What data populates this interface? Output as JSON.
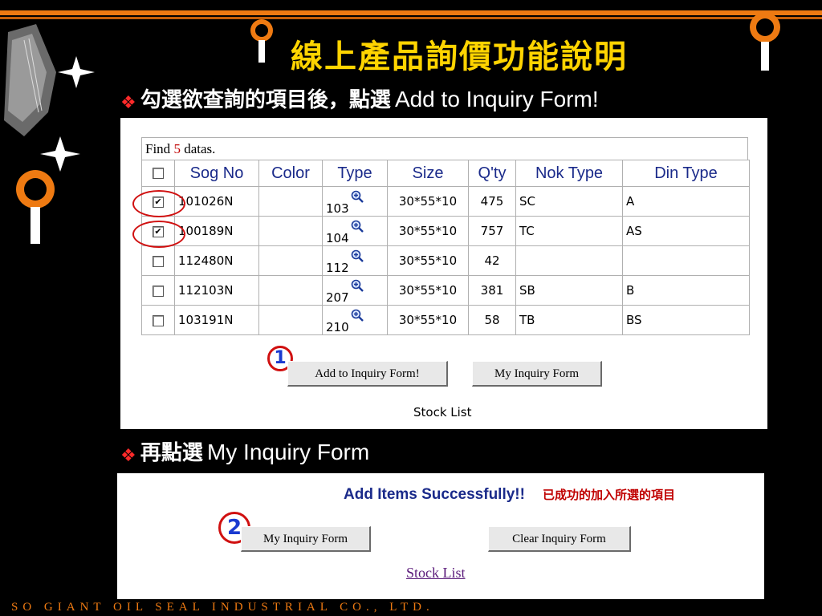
{
  "slide": {
    "title": "線上產品詢價功能說明",
    "bullet1_zh": "勾選欲查詢的項目後，點選",
    "bullet1_en": "Add to Inquiry Form!",
    "bullet2_zh": "再點選",
    "bullet2_en": "My Inquiry Form",
    "bullet_symbol": "❖",
    "footer": "SO GIANT OIL SEAL INDUSTRIAL CO., LTD."
  },
  "panel1": {
    "find_prefix": "Find ",
    "find_count": "5",
    "find_suffix": " datas.",
    "columns": [
      "Sog No",
      "Color",
      "Type",
      "Size",
      "Q'ty",
      "Nok Type",
      "Din Type"
    ],
    "rows": [
      {
        "checked": true,
        "sog_no": "101026N",
        "color": "",
        "type": "103",
        "size": "30*55*10",
        "qty": "475",
        "nok_type": "SC",
        "din_type": "A"
      },
      {
        "checked": true,
        "sog_no": "100189N",
        "color": "",
        "type": "104",
        "size": "30*55*10",
        "qty": "757",
        "nok_type": "TC",
        "din_type": "AS"
      },
      {
        "checked": false,
        "sog_no": "112480N",
        "color": "",
        "type": "112",
        "size": "30*55*10",
        "qty": "42",
        "nok_type": "",
        "din_type": ""
      },
      {
        "checked": false,
        "sog_no": "112103N",
        "color": "",
        "type": "207",
        "size": "30*55*10",
        "qty": "381",
        "nok_type": "SB",
        "din_type": "B"
      },
      {
        "checked": false,
        "sog_no": "103191N",
        "color": "",
        "type": "210",
        "size": "30*55*10",
        "qty": "58",
        "nok_type": "TB",
        "din_type": "BS"
      }
    ],
    "step_label": "1",
    "add_button": "Add to Inquiry Form!",
    "my_inquiry_button": "My Inquiry Form",
    "stock_list": "Stock List"
  },
  "panel2": {
    "success_message": "Add Items Successfully!!",
    "success_message_zh": "已成功的加入所選的項目",
    "step_label": "2",
    "my_inquiry_button": "My Inquiry Form",
    "clear_button": "Clear Inquiry Form",
    "stock_list_link": "Stock List"
  },
  "colors": {
    "title": "#ffd400",
    "accent_orange": "#ee7a12",
    "header_text": "#1a2a8a",
    "highlight_red": "#d01010",
    "step_number": "#1a3ad0"
  }
}
